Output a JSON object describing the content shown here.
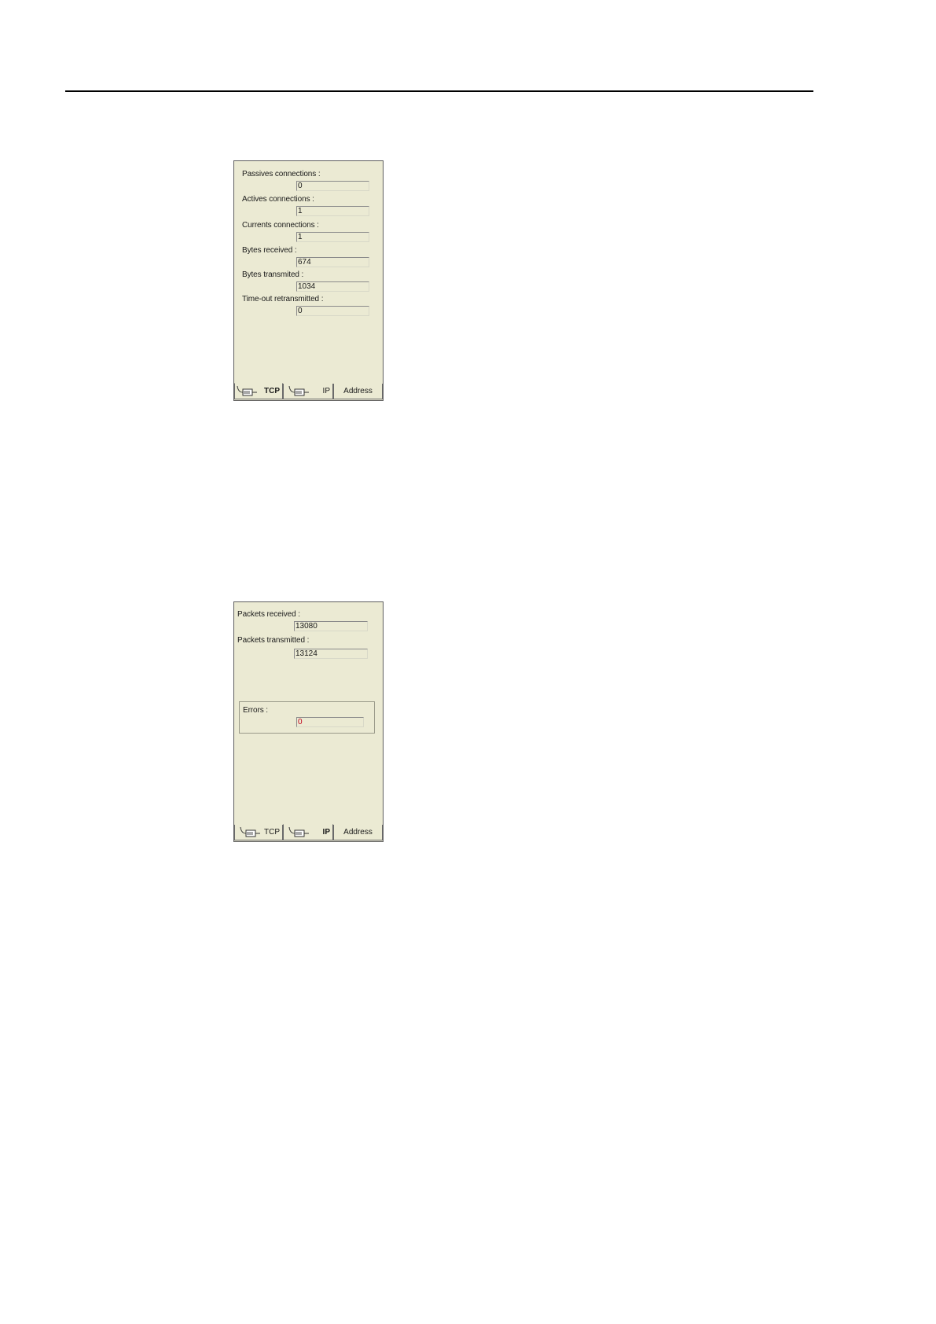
{
  "tcp_panel": {
    "fields": [
      {
        "label": "Passives connections :",
        "value": "0"
      },
      {
        "label": "Actives connections :",
        "value": "1"
      },
      {
        "label": "Currents connections :",
        "value": "1"
      },
      {
        "label": "Bytes received :",
        "value": "674"
      },
      {
        "label": "Bytes transmited :",
        "value": "1034"
      },
      {
        "label": "Time-out retransmitted :",
        "value": "0"
      }
    ],
    "tabs": {
      "tcp": "TCP",
      "ip": "IP",
      "address": "Address"
    },
    "active_tab": "TCP"
  },
  "ip_panel": {
    "fields": [
      {
        "label": "Packets received :",
        "value": "13080"
      },
      {
        "label": "Packets transmitted :",
        "value": "13124"
      }
    ],
    "errors": {
      "label": "Errors :",
      "value": "0",
      "value_color": "#c0001a"
    },
    "tabs": {
      "tcp": "TCP",
      "ip": "IP",
      "address": "Address"
    },
    "active_tab": "IP"
  },
  "colors": {
    "panel_background": "#ebead3",
    "error_text": "#c0001a"
  },
  "icons": [
    "network-connector-icon"
  ]
}
